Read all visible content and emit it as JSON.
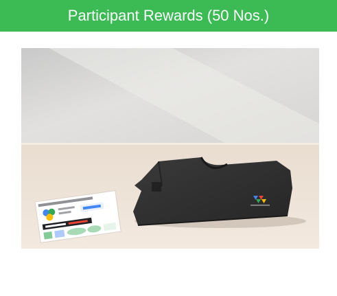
{
  "header": {
    "title": "Participant Rewards (50 Nos.)",
    "background_color": "#3cba54",
    "text_color": "#ffffff"
  },
  "photo": {
    "subject": "black t-shirt and sticker sheet",
    "wall_color": "#dcdcdc",
    "table_color": "#efe3d6",
    "shirt_color": "#2d2d2d"
  }
}
